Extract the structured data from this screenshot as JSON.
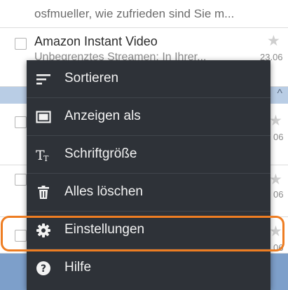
{
  "list": {
    "top_snippet": "osfmueller, wie zufrieden sind Sie m...",
    "row1": {
      "sender": "Amazon Instant Video",
      "snippet": "Unbegrenztes Streamen: In Ihrer...",
      "date": "23.06"
    },
    "partial_dates": [
      "06",
      "06",
      "06"
    ]
  },
  "menu": {
    "items": [
      {
        "label": "Sortieren",
        "icon": "sort-icon"
      },
      {
        "label": "Anzeigen als",
        "icon": "view-as-icon"
      },
      {
        "label": "Schriftgröße",
        "icon": "font-size-icon"
      },
      {
        "label": "Alles löschen",
        "icon": "trash-icon"
      },
      {
        "label": "Einstellungen",
        "icon": "gear-icon"
      },
      {
        "label": "Hilfe",
        "icon": "help-icon"
      }
    ]
  },
  "colors": {
    "menu_bg": "#2e3238",
    "highlight": "#ee7d22",
    "selection_band": "#7d9fca",
    "section_bar": "#b9cde5"
  }
}
